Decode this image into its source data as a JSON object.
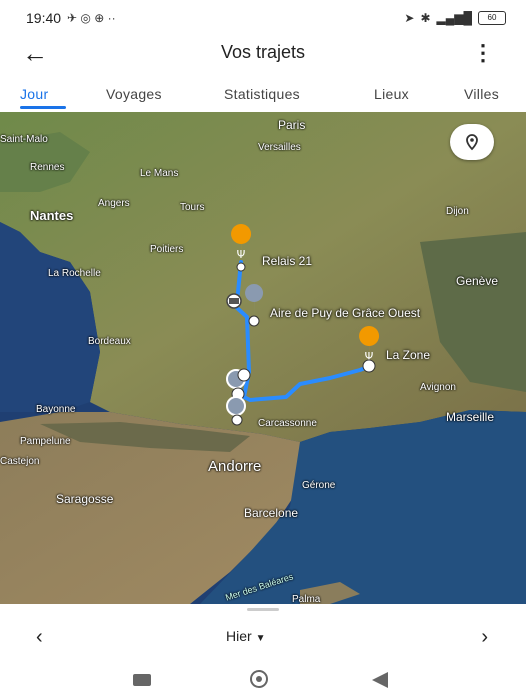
{
  "status_bar": {
    "time": "19:40",
    "battery": "60"
  },
  "app_bar": {
    "title": "Vos trajets"
  },
  "tabs": [
    {
      "label": "Jour",
      "active": true
    },
    {
      "label": "Voyages"
    },
    {
      "label": "Statistiques"
    },
    {
      "label": "Lieux"
    },
    {
      "label": "Villes"
    }
  ],
  "map": {
    "places": {
      "paris": "Paris",
      "versailles": "Versailles",
      "saint_malo": "Saint-Malo",
      "rennes": "Rennes",
      "le_mans": "Le Mans",
      "angers": "Angers",
      "tours": "Tours",
      "nantes": "Nantes",
      "dijon": "Dijon",
      "poitiers": "Poitiers",
      "la_rochelle": "La Rochelle",
      "geneve": "Genève",
      "bordeaux": "Bordeaux",
      "avignon": "Avignon",
      "bayonne": "Bayonne",
      "carcassonne": "Carcassonne",
      "marseille": "Marseille",
      "pampelune": "Pampelune",
      "castejon": "Castejon",
      "andorre": "Andorre",
      "gerone": "Gérone",
      "saragosse": "Saragosse",
      "barcelone": "Barcelone",
      "mer_baleares": "Mer des Baléares",
      "palma": "Palma"
    },
    "pois": {
      "relais": "Relais 21",
      "aire": "Aire de Puy de Grâce Ouest",
      "zone": "La Zone"
    },
    "route_color": "#2a8cff",
    "poi_food_color": "#f29900"
  },
  "bottom": {
    "day_label": "Hier"
  }
}
